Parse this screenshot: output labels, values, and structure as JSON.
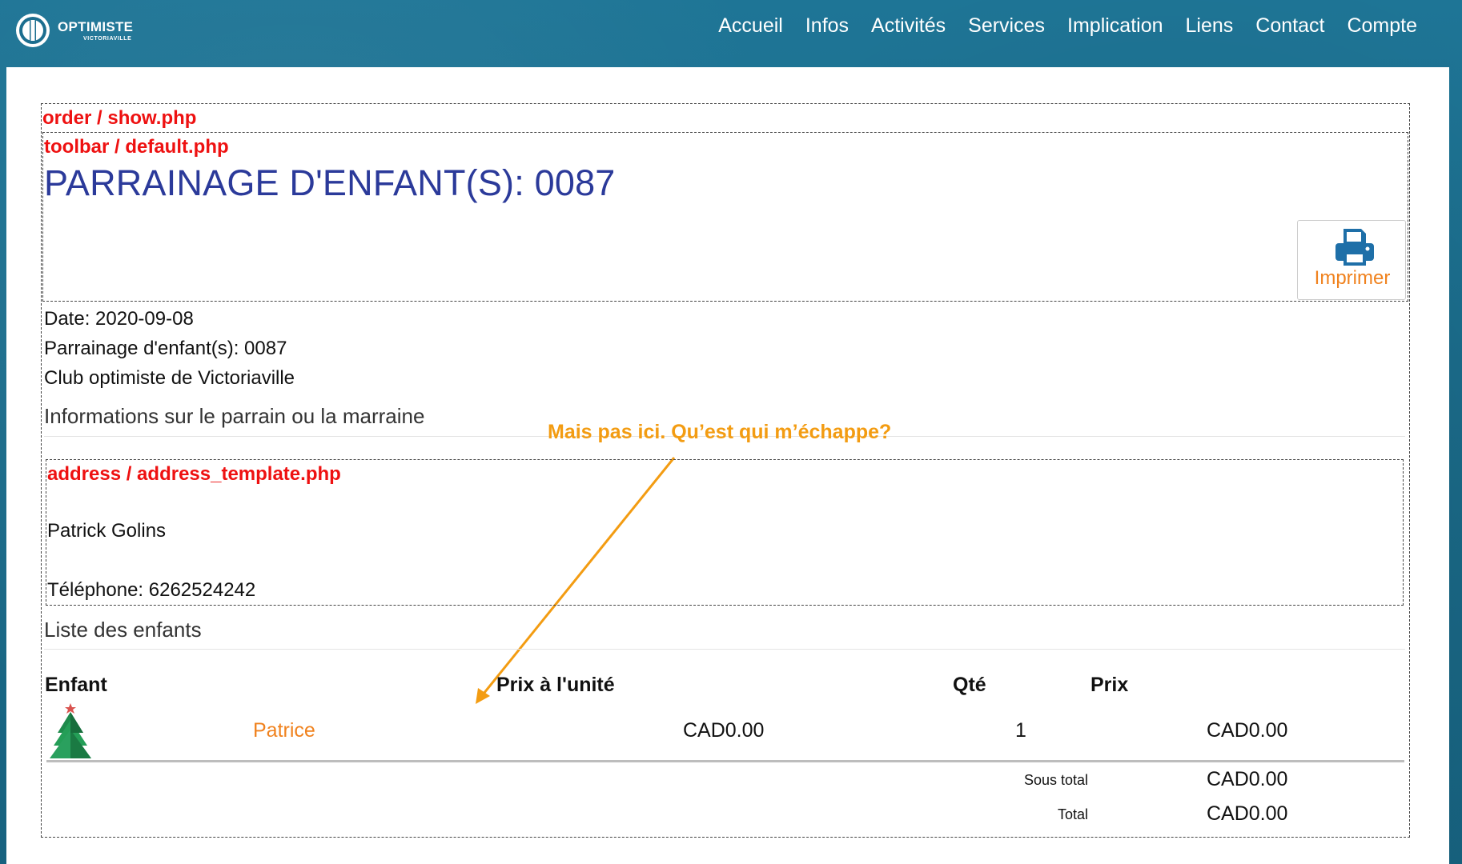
{
  "header": {
    "logo": {
      "title": "OPTIMISTE",
      "subtitle": "VICTORIAVILLE"
    },
    "nav": [
      {
        "label": "Accueil"
      },
      {
        "label": "Infos"
      },
      {
        "label": "Activités"
      },
      {
        "label": "Services"
      },
      {
        "label": "Implication"
      },
      {
        "label": "Liens"
      },
      {
        "label": "Contact"
      },
      {
        "label": "Compte"
      }
    ]
  },
  "debug_labels": {
    "order": "order / show.php",
    "toolbar": "toolbar / default.php",
    "address": "address / address_template.php"
  },
  "page": {
    "title": "PARRAINAGE D'ENFANT(S): 0087",
    "print_button": "Imprimer"
  },
  "order_info": {
    "date": "Date: 2020-09-08",
    "number": "Parrainage d'enfant(s): 0087",
    "club": "Club optimiste de Victoriaville"
  },
  "sponsor": {
    "heading": "Informations sur le parrain ou la marraine",
    "name": "Patrick Golins",
    "phone": "Téléphone: 6262524242"
  },
  "annotation": "Mais pas ici. Qu’est qui m’échappe?",
  "children": {
    "heading": "Liste des enfants",
    "columns": [
      "Enfant",
      "Prix à l'unité",
      "Qté",
      "Prix"
    ],
    "rows": [
      {
        "name": "Patrice",
        "unit_price": "CAD0.00",
        "qty": "1",
        "price": "CAD0.00"
      }
    ],
    "subtotal_label": "Sous total",
    "subtotal": "CAD0.00",
    "total_label": "Total",
    "total": "CAD0.00"
  },
  "colors": {
    "header_bg": "#1c6e8f",
    "title": "#2b3a9a",
    "accent_orange": "#f0821e",
    "debug_red": "#ee1111",
    "print_icon": "#1e6fa8"
  },
  "icons": {
    "logo": "optimist-logo-icon",
    "print": "printer-icon",
    "product": "christmas-tree-icon"
  }
}
